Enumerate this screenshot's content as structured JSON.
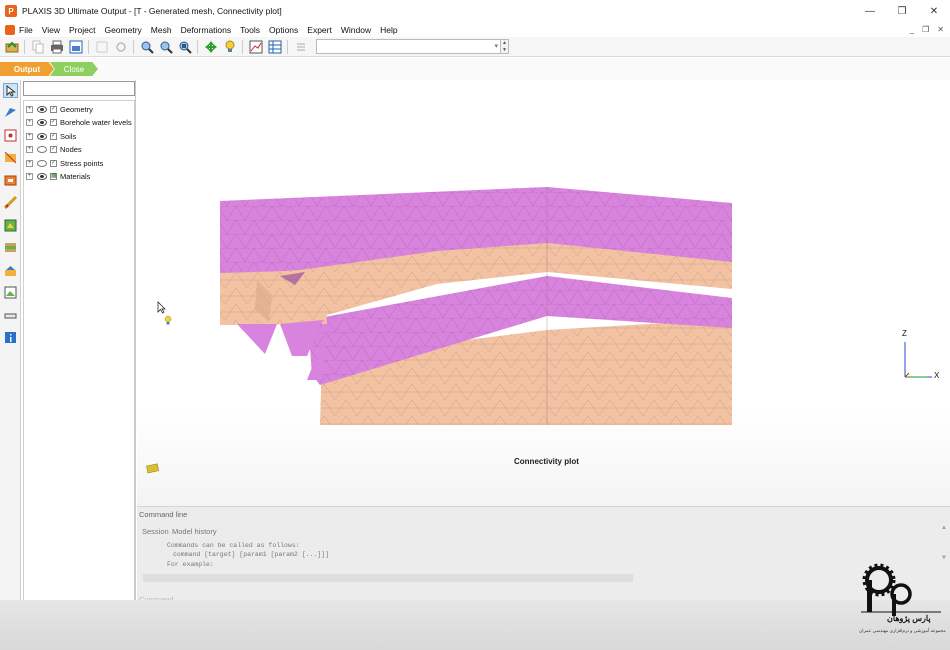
{
  "window": {
    "title": "PLAXIS 3D Ultimate Output - [T - Generated mesh, Connectivity plot]"
  },
  "menu": [
    "File",
    "View",
    "Project",
    "Geometry",
    "Mesh",
    "Deformations",
    "Tools",
    "Options",
    "Expert",
    "Window",
    "Help"
  ],
  "tabs": {
    "output": "Output",
    "close": "Close"
  },
  "explorer": {
    "search_value": "",
    "items": [
      {
        "label": "Geometry",
        "eye": "filled",
        "check": "✓"
      },
      {
        "label": "Borehole water levels",
        "eye": "filled",
        "check": "✓"
      },
      {
        "label": "Soils",
        "eye": "filled",
        "check": "✓"
      },
      {
        "label": "Nodes",
        "eye": "open",
        "check": "✓"
      },
      {
        "label": "Stress points",
        "eye": "open",
        "check": "✓"
      },
      {
        "label": "Materials",
        "eye": "filled",
        "check": "▦"
      }
    ]
  },
  "viewport": {
    "plot_title": "Connectivity plot",
    "axes": {
      "z": "Z",
      "x": "X"
    },
    "colors": {
      "clay_pink": "#d884de",
      "sand_peach": "#f2c2a2",
      "mesh_line": "#a05a9a"
    }
  },
  "command": {
    "header": "Command line",
    "tabs": [
      "Session",
      "Model history"
    ],
    "lines": [
      "Commands can be called as follows:",
      "command [target] [param1 [param2 [...]]]",
      "For example:"
    ],
    "input_label": "Command"
  },
  "watermark": {
    "brand": "Pars Pazhouhan",
    "text_fa": "پارس پژوهان",
    "subtext_fa": "مجموعه آموزشی و نرم‌افزاری مهندسی عمران"
  }
}
